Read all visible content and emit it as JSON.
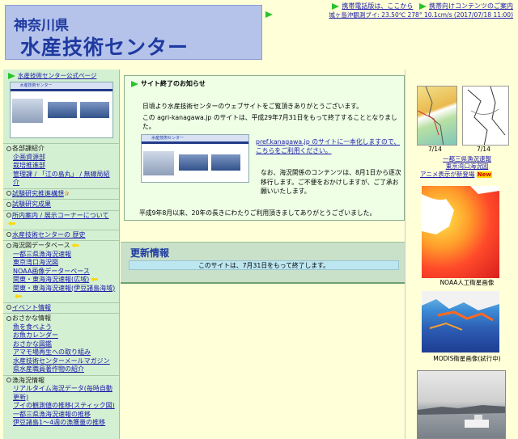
{
  "header": {
    "line1": "神奈川県",
    "line2": "水産技術センター"
  },
  "top_links": {
    "mobile_board": "携帯電話版は、ここから",
    "mobile_content": "携帯向けコンテンツのご案内",
    "buoy": "城ヶ島沖観測ブイ: 23.50℃  278°  10.1cm/s (2017/07/18 11:00)"
  },
  "leftnav": {
    "official_site": "水産技術センター公式ページ",
    "thumb_title": "水産技術センター",
    "sections": [
      {
        "title": "各部課紹介",
        "items": [
          "企画資源部",
          "栽培推進部",
          "管理課 / 「江の島丸」 / 無線局紹介"
        ]
      },
      {
        "title": "試験研究推進構想",
        "items": []
      },
      {
        "title": "試験研究成果",
        "items": []
      },
      {
        "title": "所内案内 / 展示コーナーについて",
        "items": []
      },
      {
        "title": "水産技術センターの 歴史",
        "items": []
      },
      {
        "title": "海況図データベース",
        "items": [
          "一都三県漁海況速報",
          "東京湾口海況図",
          "NOAA画像データーベース",
          "関東・東海海況速報(広域)",
          "関東・東海海況速報(伊豆諸島海域)"
        ]
      },
      {
        "title": "イベント情報",
        "items": []
      },
      {
        "title": "おさかな情報",
        "items": [
          "魚を食べよう",
          "お魚カレンダー",
          "おさかな図鑑",
          "アマモ場再生への取り組み",
          "水産技術センターメールマガジン",
          "県水産職員著作物の紹介"
        ]
      },
      {
        "title": "漁海況情報",
        "items": [
          "リアルタイム海況データ(毎時自動更新)",
          "ブイの観測値の推移(スティック図)",
          "一都三県漁海況速報の推移",
          "伊豆諸島1～4週の漁獲量の推移",
          "定置網(兵庫県)即時更新)"
        ]
      }
    ]
  },
  "notice": {
    "heading": "サイト終了のお知らせ",
    "p1": "日頃より水産技術センターのウェブサイトをご覧頂きありがとうございます。",
    "p2": "この agri-kanagawa.jp のサイトは、平成29年7月31日をもって終了することとなりました。",
    "p3_link": "pref.kanagawa.jp のサイトに一本化しますので、こちらをご利用ください。",
    "p4": "なお、海況関係のコンテンツは、8月1日から逐次移行します。ご不便をおかけしますが、ご了承お願いいたします。",
    "p5": "平成9年8月以来、20年の長きにわたりご利用頂きましてありがとうございました。",
    "thumb_title": "水産技術センター"
  },
  "update": {
    "heading": "更新情報",
    "message": "このサイトは、7月31日をもって終了します。"
  },
  "right": {
    "date1": "7/14",
    "date2": "7/14",
    "map_caption1": "一都三県漁況速報",
    "map_caption2": "東京湾口海況図",
    "anime": "アニメ表示が新登場",
    "new_badge": "New",
    "noaa_caption": "NOAA人工衛星画像",
    "modis_caption": "MODIS衛星画像(試行中)"
  },
  "colors": {
    "header_bg": "#b5c3eb",
    "title_blue": "#1f3aa0",
    "nav_bg": "#d4f0d2",
    "notice_bg": "#eeffe6",
    "page_bg": "#ffffd8",
    "link": "#1a1aa8"
  }
}
